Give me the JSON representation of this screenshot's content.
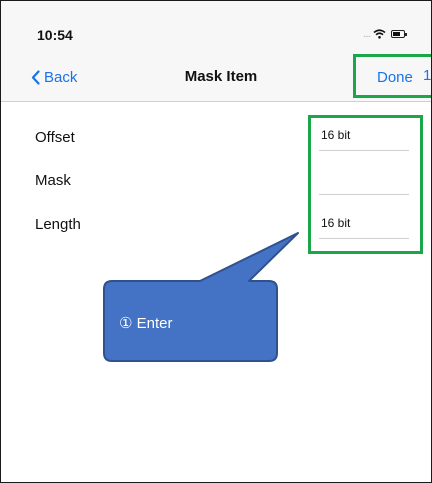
{
  "status_bar": {
    "time": "10:54",
    "signal_glyph": "....",
    "icons": [
      "signal-icon",
      "wifi-icon",
      "battery-icon"
    ]
  },
  "nav": {
    "back_label": "Back",
    "title": "Mask Item",
    "done_label": "Done",
    "edge_char": "1"
  },
  "form": {
    "rows": [
      {
        "label": "Offset",
        "value": "16 bit"
      },
      {
        "label": "Mask",
        "value": ""
      },
      {
        "label": "Length",
        "value": "16 bit"
      }
    ]
  },
  "annotation": {
    "callout_text": "① Enter"
  },
  "colors": {
    "accent_blue": "#1a73e8",
    "highlight_green": "#1ca64a",
    "callout_fill": "#4472c4",
    "callout_border": "#2f528f",
    "nav_background": "#f7f7f8"
  }
}
